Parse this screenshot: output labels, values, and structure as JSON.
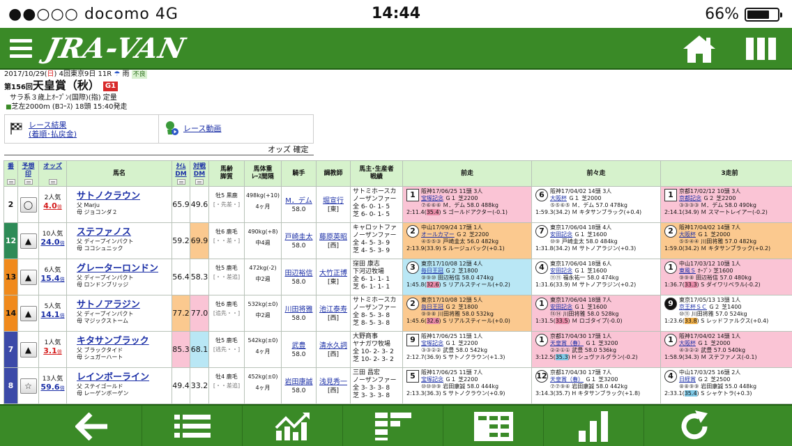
{
  "status": {
    "carrier": "●●○○○ docomo   4G",
    "time": "14:44",
    "battery": "66%"
  },
  "app": {
    "logo": "JRA-VAN"
  },
  "race": {
    "date_prefix": "2017/10/29(",
    "day": "日",
    "date_suffix": ") 4回東京9日 11R",
    "weather": "雨",
    "track_cond": "不良",
    "round": "第156回",
    "name": "天皇賞（秋）",
    "grade": "G1",
    "conditions": "サラ系３歳上ｵｰﾌﾟﾝ(国際)(指) 定量",
    "course": "芝左2000m (Bｺｰｽ) 18頭 15:40発走"
  },
  "links": {
    "result": "レース結果\n(着順･払戻金)",
    "video": "レース動画"
  },
  "odds_status": "オッズ 確定",
  "headers": {
    "num": "番",
    "mark": "予想\n印",
    "odds": "オッズ",
    "horse": "馬名",
    "time_dm": "ﾀｲﾑ\nDM",
    "match_dm": "対戦\nDM",
    "age": "馬齢\n脚質",
    "weight": "馬体重\nﾚｰｽ間隔",
    "jockey": "騎手",
    "trainer": "調教師",
    "owner": "馬主･生産者\n戦績",
    "prev1": "前走",
    "prev2": "前々走",
    "prev3": "3走前"
  },
  "rows": [
    {
      "num": "2",
      "num_color": "#ffffff",
      "num_text": "#111111",
      "mark": "◯",
      "pop": "2人気",
      "odds": "4.0",
      "fav": true,
      "name": "サトノクラウン",
      "sire": "父 Marju",
      "dam": "母 ジョコンダ２",
      "tdm": "65.9",
      "tdm_bg": "bg-white",
      "mdm": "49.6",
      "mdm_bg": "bg-white",
      "age": "牡5 黒鹿",
      "style": "[・先差・]",
      "wt": "498kg(+10)",
      "interval": "4ヶ月",
      "jockey": "M．デム",
      "jw": "58.0",
      "trainer": "堀宣行",
      "region": "[東]",
      "owner": "サトミホースカ\nノーザンファー\n全 6- 0- 1- 5\n芝 6- 0- 1- 5",
      "races": [
        {
          "bg": "bg-pink",
          "pos": "1",
          "shape": "sq",
          "l1": "阪神17/06/25 11頭 3人",
          "rn": "宝塚記念",
          "l2": " Ｇ１ 芝2200",
          "pass": "⑦⑥⑥⑥",
          "l3": " Ｍ．デム 58.0 488kg",
          "t_pre": "2:11.4(",
          "t_hl": "35.4",
          "t_hl_c": "",
          "t_post": ") S ゴールドアクター(-0.1)"
        },
        {
          "bg": "bg-white",
          "pos": "6",
          "shape": "circ",
          "l1": "阪神17/04/02 14頭 3人",
          "rn": "大阪杯",
          "l2": " Ｇ１ 芝2000",
          "pass": "⑤⑤⑥⑤",
          "l3": " Ｍ．デム 57.0 478kg",
          "t_pre": "1:59.3(34.2) Ｍ キタサンブラック(+0.4)",
          "t_hl": "",
          "t_hl_c": "",
          "t_post": ""
        },
        {
          "bg": "bg-pink",
          "pos": "1",
          "shape": "sq",
          "l1": "京都17/02/12 10頭 3人",
          "rn": "京都記念",
          "l2": " Ｇ２ 芝2200",
          "pass": "③③③③",
          "l3": " Ｍ．デム 58.0 490kg",
          "t_pre": "2:14.1(34.9) Ｍ スマートレイアー(-0.2)",
          "t_hl": "",
          "t_hl_c": "",
          "t_post": ""
        }
      ]
    },
    {
      "num": "12",
      "num_color": "#2e8b57",
      "num_text": "#ffffff",
      "mark": "▲",
      "pop": "10人気",
      "odds": "24.0",
      "fav": false,
      "name": "ステファノス",
      "sire": "父 ディープインパクト",
      "dam": "母 ココシュニック",
      "tdm": "59.2",
      "tdm_bg": "bg-white",
      "mdm": "69.9",
      "mdm_bg": "bg-orange",
      "age": "牡6 鹿毛",
      "style": "[・・差・]",
      "wt": "490kg(+8)",
      "interval": "中4週",
      "jockey": "戸崎圭太",
      "jw": "58.0",
      "trainer": "藤原英昭",
      "region": "[西]",
      "owner": "キャロットファ\nノーザンファー\n全 4- 5- 3- 9\n芝 4- 5- 3- 9",
      "races": [
        {
          "bg": "bg-orange",
          "pos": "2",
          "shape": "circ",
          "l1": "中山17/09/24 17頭 1人",
          "rn": "オールカマー",
          "l2": " Ｇ２ 芝2200",
          "pass": "④⑤⑤③",
          "l3": " 戸崎圭太 56.0 482kg",
          "t_pre": "2:13.9(33.9) S ルージュバック(+0.1)",
          "t_hl": "",
          "t_hl_c": "",
          "t_post": ""
        },
        {
          "bg": "bg-white",
          "pos": "7",
          "shape": "circ",
          "l1": "東京17/06/04 18頭 4人",
          "rn": "安田記念",
          "l2": " Ｇ１ 芝1600",
          "pass": "⑩⑨",
          "l3": " 戸崎圭太 58.0 484kg",
          "t_pre": "1:31.8(34.2) Ｍ サトノアラジン(+0.3)",
          "t_hl": "",
          "t_hl_c": "",
          "t_post": ""
        },
        {
          "bg": "bg-orange",
          "pos": "2",
          "shape": "circ",
          "l1": "阪神17/04/02 14頭 7人",
          "rn": "大阪杯",
          "l2": " Ｇ１ 芝2000",
          "pass": "⑤⑤④④",
          "l3": " 川田将雅 57.0 482kg",
          "t_pre": "1:59.0(34.2) Ｍ キタサンブラック(+0.2)",
          "t_hl": "",
          "t_hl_c": "",
          "t_post": ""
        }
      ]
    },
    {
      "num": "13",
      "num_color": "#f08a1c",
      "num_text": "#111111",
      "mark": "▲",
      "pop": "6人気",
      "odds": "15.4",
      "fav": false,
      "name": "グレーターロンドン",
      "sire": "父 ディープインパクト",
      "dam": "母 ロンドンブリッジ",
      "tdm": "56.4",
      "tdm_bg": "bg-white",
      "mdm": "58.3",
      "mdm_bg": "bg-white",
      "age": "牡5 鹿毛",
      "style": "[・・差追]",
      "wt": "472kg(-2)",
      "interval": "中2週",
      "jockey": "田辺裕信",
      "jw": "58.0",
      "trainer": "大竹正博",
      "region": "[東]",
      "owner": "窪田 康志\n下河辺牧場\n全 6- 1- 1- 1\n芝 6- 1- 1- 1",
      "races": [
        {
          "bg": "bg-blue",
          "pos": "3",
          "shape": "circ",
          "l1": "東京17/10/08 12頭 4人",
          "rn": "毎日王冠",
          "l2": " Ｇ２ 芝1800",
          "pass": "⑨⑨⑩",
          "l3": " 田辺裕信 58.0 474kg",
          "t_pre": "1:45.8(",
          "t_hl": "32.6",
          "t_hl_c": "",
          "t_post": ") S リアルスティール(+0.2)"
        },
        {
          "bg": "bg-white",
          "pos": "4",
          "shape": "circ",
          "l1": "東京17/06/04 18頭 6人",
          "rn": "安田記念",
          "l2": " Ｇ１ 芝1600",
          "pass": "⑪⑪",
          "l3": " 福永祐一 58.0 474kg",
          "t_pre": "1:31.6(33.9) Ｍ サトノアラジン(+0.2)",
          "t_hl": "",
          "t_hl_c": "",
          "t_post": ""
        },
        {
          "bg": "bg-pink",
          "pos": "1",
          "shape": "circ",
          "l1": "中山17/03/12 10頭 1人",
          "rn": "東風Ｓ",
          "l2": " ｵｰﾌﾟﾝ 芝1600",
          "pass": "⑨⑨⑧",
          "l3": " 田辺裕信 57.0 480kg",
          "t_pre": "1:36.7(",
          "t_hl": "33.3",
          "t_hl_c": "",
          "t_post": ") S ダイワリベラル(-0.2)"
        }
      ]
    },
    {
      "num": "14",
      "num_color": "#f08a1c",
      "num_text": "#111111",
      "mark": "▲",
      "pop": "5人気",
      "odds": "14.1",
      "fav": false,
      "name": "サトノアラジン",
      "sire": "父 ディープインパクト",
      "dam": "母 マジックストーム",
      "tdm": "77.2",
      "tdm_bg": "bg-orange",
      "mdm": "77.0",
      "mdm_bg": "bg-pink",
      "age": "牡6 鹿毛",
      "style": "[追先・・]",
      "wt": "532kg(±0)",
      "interval": "中2週",
      "jockey": "川田将雅",
      "jw": "58.0",
      "trainer": "池江泰寿",
      "region": "[西]",
      "owner": "サトミホースカ\nノーザンファー\n全 8- 5- 3- 8\n芝 8- 5- 3- 8",
      "races": [
        {
          "bg": "bg-orange",
          "pos": "2",
          "shape": "circ",
          "l1": "東京17/10/08 12頭 5人",
          "rn": "毎日王冠",
          "l2": " Ｇ２ 芝1800",
          "pass": "⑨⑨⑧",
          "l3": " 川田将雅 58.0 532kg",
          "t_pre": "1:45.6(",
          "t_hl": "32.6",
          "t_hl_c": "",
          "t_post": ") S リアルスティール(+0.0)"
        },
        {
          "bg": "bg-pink",
          "pos": "1",
          "shape": "circ",
          "l1": "東京17/06/04 18頭 7人",
          "rn": "安田記念",
          "l2": " Ｇ１ 芝1600",
          "pass": "⑮⑭",
          "l3": " 川田将雅 58.0 528kg",
          "t_pre": "1:31.5(",
          "t_hl": "33.5",
          "t_hl_c": "",
          "t_post": ") Ｍ ロゴタイプ(-0.0)"
        },
        {
          "bg": "bg-white",
          "pos": "9",
          "shape": "black",
          "l1": "東京17/05/13 13頭 1人",
          "rn": "京王杯ＳＣ",
          "l2": " Ｇ２ 芝1400",
          "pass": "⑩⑪",
          "l3": " 川田将雅 57.0 524kg",
          "t_pre": "1:23.6(",
          "t_hl": "33.8",
          "t_hl_c": "o",
          "t_post": ") S レッドファルクス(+0.4)"
        }
      ]
    },
    {
      "num": "7",
      "num_color": "#3b4aa8",
      "num_text": "#ffffff",
      "mark": "▲",
      "pop": "1人気",
      "odds": "3.1",
      "fav": true,
      "name": "キタサンブラック",
      "sire": "父 ブラックタイド",
      "dam": "母 シュガーハート",
      "tdm": "85.3",
      "tdm_bg": "bg-pink",
      "mdm": "68.1",
      "mdm_bg": "bg-blue",
      "age": "牡5 鹿毛",
      "style": "[逃先・・]",
      "wt": "542kg(±0)",
      "interval": "4ヶ月",
      "jockey": "武豊",
      "jw": "58.0",
      "trainer": "清水久詞",
      "region": "[西]",
      "owner": "大野商事\nヤナガワ牧場\n全 10- 2- 3- 2\n芝 10- 2- 3- 2",
      "races": [
        {
          "bg": "bg-white",
          "pos": "9",
          "shape": "sq",
          "l1": "阪神17/06/25 11頭 1人",
          "rn": "宝塚記念",
          "l2": " Ｇ１ 芝2200",
          "pass": "③③②②",
          "l3": " 武豊 58.0 542kg",
          "t_pre": "2:12.7(36.9) S サトノクラウン(+1.3)",
          "t_hl": "",
          "t_hl_c": "",
          "t_post": ""
        },
        {
          "bg": "bg-pink",
          "pos": "1",
          "shape": "circ",
          "l1": "京都17/04/30 17頭 1人",
          "rn": "天皇賞（春）",
          "l2": " Ｇ１ 芝3200",
          "pass": "②②①①",
          "l3": " 武豊 58.0 536kg",
          "t_pre": "3:12.5(",
          "t_hl": "35.3",
          "t_hl_c": "b",
          "t_post": ") H シュヴァルグラン(-0.2)"
        },
        {
          "bg": "bg-pink",
          "pos": "1",
          "shape": "circ",
          "l1": "阪神17/04/02 14頭 1人",
          "rn": "大阪杯",
          "l2": " Ｇ１ 芝2000",
          "pass": "④③②②",
          "l3": " 武豊 57.0 540kg",
          "t_pre": "1:58.9(34.3) Ｍ ステファノス(-0.1)",
          "t_hl": "",
          "t_hl_c": "",
          "t_post": ""
        }
      ]
    },
    {
      "num": "8",
      "num_color": "#3b4aa8",
      "num_text": "#ffffff",
      "mark": "☆",
      "pop": "13人気",
      "odds": "59.6",
      "fav": false,
      "name": "レインボーライン",
      "sire": "父 ステイゴールド",
      "dam": "母 レーゲンボーゲン",
      "tdm": "49.4",
      "tdm_bg": "bg-white",
      "mdm": "33.2",
      "mdm_bg": "bg-white",
      "age": "牡4 鹿毛",
      "style": "[・・差追]",
      "wt": "452kg(±0)",
      "interval": "4ヶ月",
      "jockey": "岩田康誠",
      "jw": "58.0",
      "trainer": "浅見秀一",
      "region": "[西]",
      "owner": "三田 昌宏\nノーザンファー\n全 3- 3- 3- 8\n芝 3- 3- 3- 8",
      "races": [
        {
          "bg": "bg-white",
          "pos": "5",
          "shape": "sq",
          "l1": "阪神17/06/25 11頭 7人",
          "rn": "宝塚記念",
          "l2": " Ｇ１ 芝2200",
          "pass": "⑩⑩⑩⑨",
          "l3": " 岩田康誠 58.0 444kg",
          "t_pre": "2:13.3(36.3) S サトノクラウン(+0.9)",
          "t_hl": "",
          "t_hl_c": "",
          "t_post": ""
        },
        {
          "bg": "bg-white",
          "pos": "12",
          "shape": "circ",
          "l1": "京都17/04/30 17頭 7人",
          "rn": "天皇賞（春）",
          "l2": " Ｇ１ 芝3200",
          "pass": "⑦⑦⑨⑥",
          "l3": " 岩田康誠 58.0 442kg",
          "t_pre": "3:14.3(35.7) H キタサンブラック(+1.8)",
          "t_hl": "",
          "t_hl_c": "",
          "t_post": ""
        },
        {
          "bg": "bg-white",
          "pos": "4",
          "shape": "circ",
          "l1": "中山17/03/25 16頭 2人",
          "rn": "日経賞",
          "l2": " Ｇ２ 芝2500",
          "pass": "⑧⑧⑨⑨",
          "l3": " 岩田康誠 55.0 448kg",
          "t_pre": "2:33.1(",
          "t_hl": "35.4",
          "t_hl_c": "b",
          "t_post": ") S シャケトラ(+0.3)"
        }
      ]
    }
  ],
  "bottom_nav": [
    "back-arrow-icon",
    "list-icon",
    "trend-chart-icon",
    "table-icon",
    "grid-icon",
    "bar-chart-icon",
    "refresh-icon"
  ]
}
